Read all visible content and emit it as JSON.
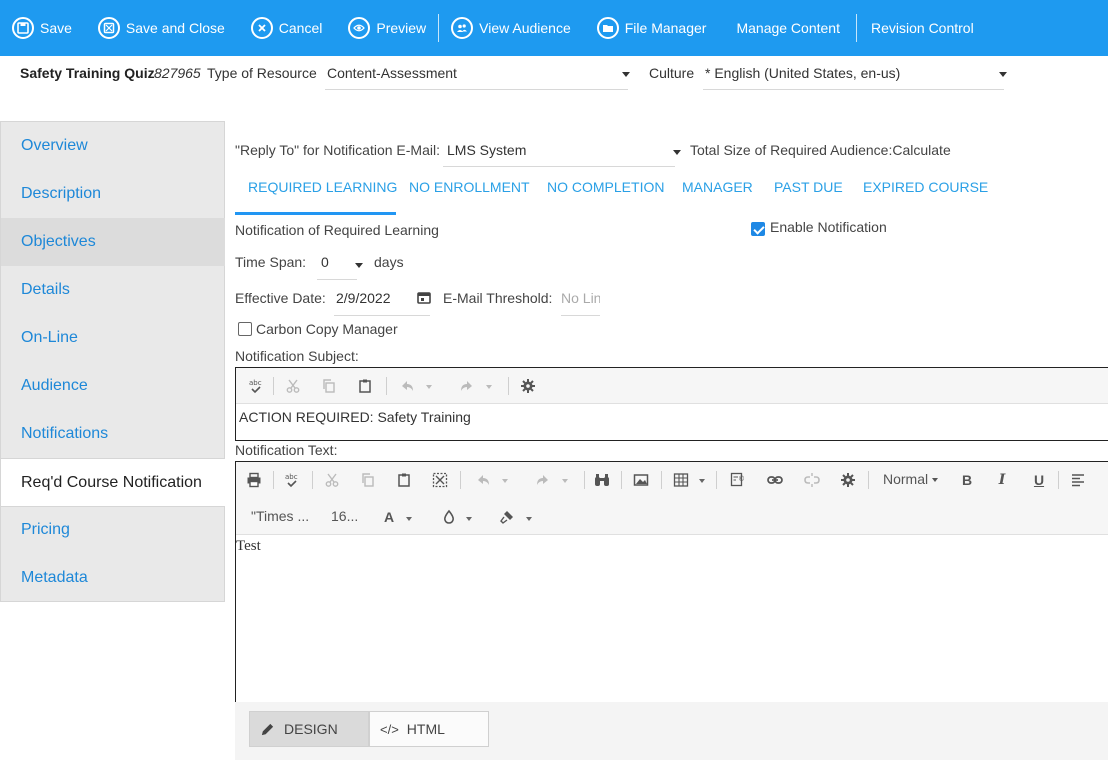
{
  "toolbar": {
    "save": "Save",
    "save_close": "Save and Close",
    "cancel": "Cancel",
    "preview": "Preview",
    "view_audience": "View Audience",
    "file_manager": "File Manager",
    "manage_content": "Manage Content",
    "revision_control": "Revision Control"
  },
  "header": {
    "title": "Safety Training Quiz",
    "id": "827965",
    "type_label": "Type of Resource",
    "type_value": "Content-Assessment",
    "culture_label": "Culture",
    "culture_value": "* English (United States, en-us)"
  },
  "sidebar": {
    "items": [
      {
        "label": "Overview"
      },
      {
        "label": "Description"
      },
      {
        "label": "Objectives"
      },
      {
        "label": "Details"
      },
      {
        "label": "On-Line"
      },
      {
        "label": "Audience"
      },
      {
        "label": "Notifications"
      },
      {
        "label": "Req'd Course Notification"
      },
      {
        "label": "Pricing"
      },
      {
        "label": "Metadata"
      }
    ],
    "hover_index": 2,
    "active_index": 7
  },
  "main": {
    "reply_to_label": "\"Reply To\" for Notification E-Mail:",
    "reply_to_value": "LMS System",
    "total_size_label": "Total Size of Required Audience:",
    "total_size_link": "Calculate",
    "tabs": [
      {
        "label": "Required Learning"
      },
      {
        "label": "No Enrollment"
      },
      {
        "label": "No Completion"
      },
      {
        "label": "Manager"
      },
      {
        "label": "Past Due"
      },
      {
        "label": "Expired Course"
      }
    ],
    "section_title": "Notification of Required Learning",
    "enable_notification_label": "Enable Notification",
    "enable_notification_checked": true,
    "time_span_label": "Time Span:",
    "time_span_value": "0",
    "time_span_unit": "days",
    "effective_date_label": "Effective Date:",
    "effective_date_value": "2/9/2022",
    "email_threshold_label": "E-Mail Threshold:",
    "email_threshold_placeholder": "No Lin",
    "carbon_copy_label": "Carbon Copy Manager",
    "carbon_copy_checked": false,
    "subject_label": "Notification Subject:",
    "subject_text": "ACTION REQUIRED: Safety Training",
    "text_label": "Notification Text:",
    "body_text": "Test",
    "format_value": "Normal",
    "font_value": "\"Times ...",
    "size_value": "16...",
    "mode_design": "Design",
    "mode_html": "HTML"
  }
}
